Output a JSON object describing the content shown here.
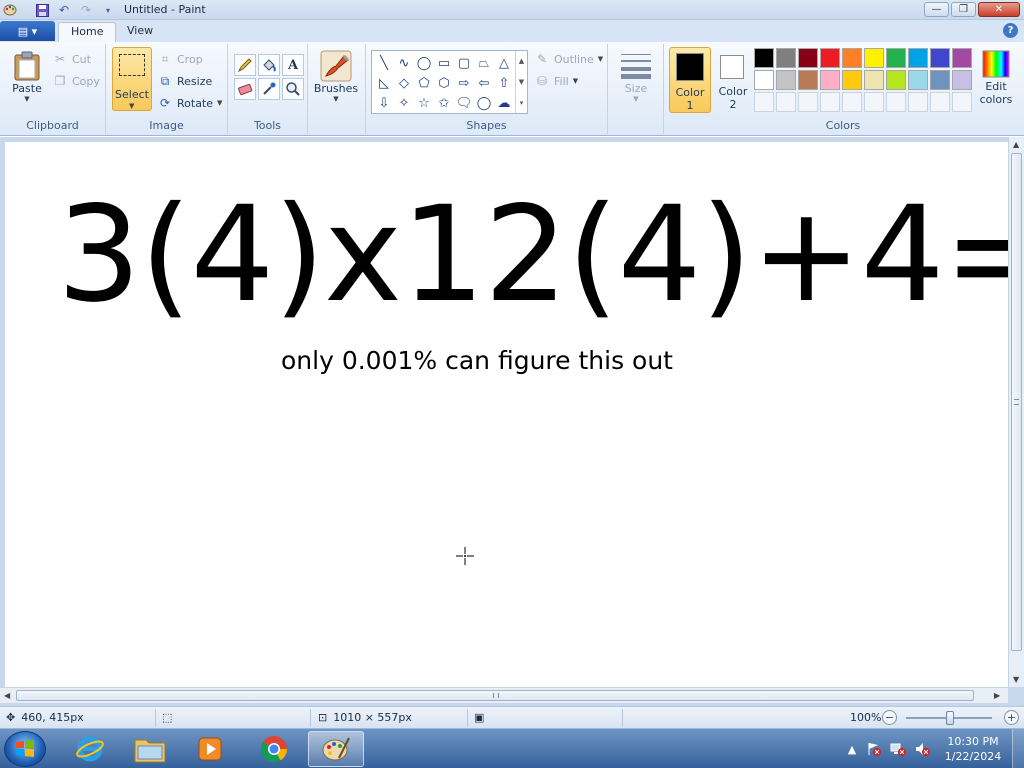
{
  "window": {
    "title": "Untitled - Paint",
    "minimize": "—",
    "maximize": "❐",
    "close": "✕"
  },
  "tabs": {
    "app_menu": "▤ ▾",
    "home": "Home",
    "view": "View",
    "help": "?"
  },
  "clipboard": {
    "paste": "Paste",
    "cut": "Cut",
    "copy": "Copy",
    "group": "Clipboard"
  },
  "image": {
    "select": "Select",
    "crop": "Crop",
    "resize": "Resize",
    "rotate": "Rotate",
    "group": "Image"
  },
  "tools": {
    "group": "Tools"
  },
  "brushes": {
    "label": "Brushes"
  },
  "shapes": {
    "outline": "Outline",
    "fill": "Fill",
    "group": "Shapes",
    "items": [
      "╲",
      "∿",
      "◯",
      "▭",
      "▢",
      "⏢",
      "△",
      "◺",
      "◇",
      "⬠",
      "⬡",
      "⇨",
      "⇦",
      "⇧",
      "⇩",
      "✧",
      "☆",
      "✩",
      "🗨",
      "◯",
      "☁"
    ]
  },
  "size": {
    "label": "Size"
  },
  "colors": {
    "color1": "Color",
    "color1_num": "1",
    "color2": "Color",
    "color2_num": "2",
    "edit_label": "Edit",
    "edit_label2": "colors",
    "group": "Colors",
    "color1_value": "#000000",
    "color2_value": "#ffffff",
    "palette_row1": [
      "#000000",
      "#7f7f7f",
      "#880015",
      "#ed1c24",
      "#ff7f27",
      "#fff200",
      "#22b14c",
      "#00a2e8",
      "#3f48cc",
      "#a349a4"
    ],
    "palette_row2": [
      "#ffffff",
      "#c3c3c3",
      "#b97a57",
      "#ffaec9",
      "#ffc90e",
      "#efe4b0",
      "#b5e61d",
      "#99d9ea",
      "#7092be",
      "#c8bfe7"
    ]
  },
  "canvas": {
    "equation": "3(4)x12(4)+4=",
    "subtitle": "only 0.001% can figure this out"
  },
  "status": {
    "cursor_pos": "460, 415px",
    "canvas_size": "1010 × 557px",
    "zoom": "100%"
  },
  "taskbar": {
    "time": "10:30 PM",
    "date": "1/22/2024"
  }
}
